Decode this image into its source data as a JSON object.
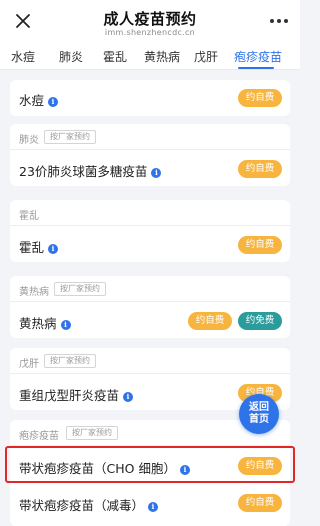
{
  "header": {
    "title": "成人疫苗预约",
    "subtitle": "imm.shenzhencdc.cn"
  },
  "tabs": [
    {
      "label": "水痘"
    },
    {
      "label": "肺炎"
    },
    {
      "label": "霍乱"
    },
    {
      "label": "黄热病"
    },
    {
      "label": "戊肝"
    },
    {
      "label": "疱疹疫苗",
      "active": true
    }
  ],
  "labels": {
    "self_pay": "约自费",
    "free": "约免费",
    "manufacturer_badge": "按厂家预约",
    "back_home_line1": "返回",
    "back_home_line2": "首页",
    "info": "i"
  },
  "sections": [
    {
      "category": "",
      "vaccines": [
        {
          "name": "水痘"
        }
      ]
    },
    {
      "category": "肺炎",
      "vaccines": [
        {
          "name": "23价肺炎球菌多糖疫苗"
        }
      ]
    },
    {
      "category": "霍乱",
      "vaccines": [
        {
          "name": "霍乱"
        }
      ]
    },
    {
      "category": "黄热病",
      "vaccines": [
        {
          "name": "黄热病"
        }
      ]
    },
    {
      "category": "戊肝",
      "vaccines": [
        {
          "name": "重组戊型肝炎疫苗"
        }
      ]
    },
    {
      "category": "疱疹疫苗",
      "vaccines": [
        {
          "name": "带状疱疹疫苗（CHO 细胞）",
          "highlighted": true
        },
        {
          "name": "带状疱疹疫苗（减毒）"
        }
      ]
    }
  ],
  "colors": {
    "accent": "#2f73e8",
    "self_pay_button": "#f7b540",
    "free_button": "#2a9c9b",
    "highlight_border": "#e02828"
  }
}
